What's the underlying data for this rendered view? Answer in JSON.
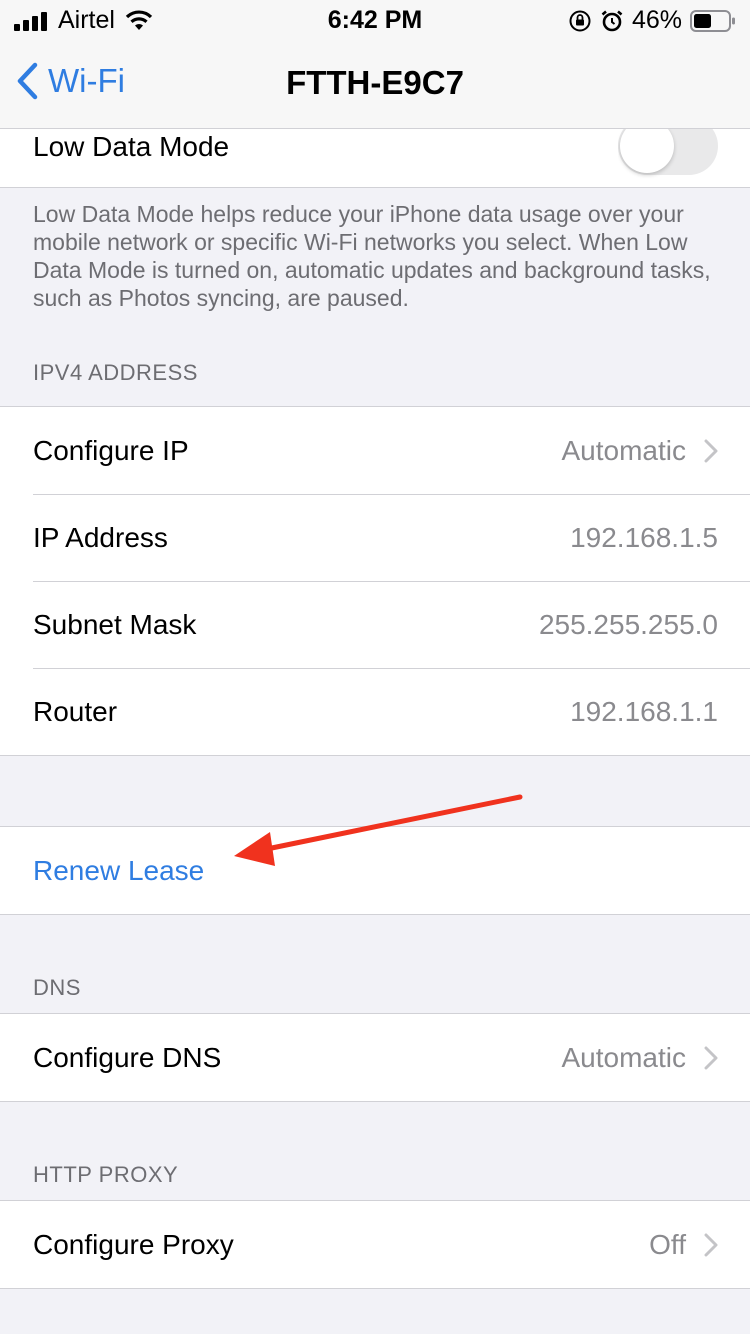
{
  "status": {
    "carrier": "Airtel",
    "time": "6:42 PM",
    "battery": "46%"
  },
  "nav": {
    "back_label": "Wi-Fi",
    "title": "FTTH-E9C7"
  },
  "low_data": {
    "label": "Low Data Mode",
    "toggle_on": false,
    "footer": "Low Data Mode helps reduce your iPhone data usage over your mobile network or specific Wi-Fi networks you select. When Low Data Mode is turned on, automatic updates and background tasks, such as Photos syncing, are paused."
  },
  "ipv4": {
    "header": "IPV4 ADDRESS",
    "rows": [
      {
        "label": "Configure IP",
        "value": "Automatic"
      },
      {
        "label": "IP Address",
        "value": "192.168.1.5"
      },
      {
        "label": "Subnet Mask",
        "value": "255.255.255.0"
      },
      {
        "label": "Router",
        "value": "192.168.1.1"
      }
    ]
  },
  "renew": {
    "label": "Renew Lease"
  },
  "dns": {
    "header": "DNS",
    "label": "Configure DNS",
    "value": "Automatic"
  },
  "proxy": {
    "header": "HTTP PROXY",
    "label": "Configure Proxy",
    "value": "Off"
  },
  "colors": {
    "accent": "#2f7de1",
    "annotation_arrow": "#f0321e"
  }
}
